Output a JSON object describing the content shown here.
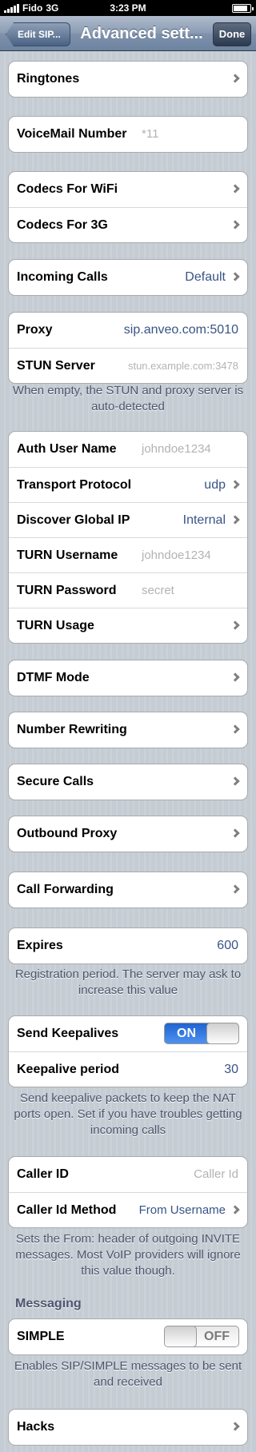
{
  "status_bar": {
    "carrier": "Fido",
    "network": "3G",
    "time": "3:23 PM"
  },
  "nav": {
    "back_label": "Edit SIP...",
    "title": "Advanced sett...",
    "done_label": "Done"
  },
  "ringtones": {
    "label": "Ringtones"
  },
  "voicemail": {
    "label": "VoiceMail Number",
    "placeholder": "*11"
  },
  "codecs": {
    "wifi_label": "Codecs For WiFi",
    "g3_label": "Codecs For 3G"
  },
  "incoming_calls": {
    "label": "Incoming Calls",
    "value": "Default"
  },
  "proxy": {
    "label": "Proxy",
    "value": "sip.anveo.com:5010",
    "stun_label": "STUN Server",
    "stun_placeholder": "stun.example.com:3478",
    "footer": "When empty, the STUN and proxy server is auto-detected"
  },
  "auth": {
    "auth_user_label": "Auth User Name",
    "auth_user_placeholder": "johndoe1234",
    "transport_label": "Transport Protocol",
    "transport_value": "udp",
    "discover_label": "Discover Global IP",
    "discover_value": "Internal",
    "turn_user_label": "TURN Username",
    "turn_user_placeholder": "johndoe1234",
    "turn_pass_label": "TURN Password",
    "turn_pass_placeholder": "secret",
    "turn_usage_label": "TURN Usage"
  },
  "menu": {
    "dtmf": "DTMF Mode",
    "number_rewriting": "Number Rewriting",
    "secure_calls": "Secure Calls",
    "outbound_proxy": "Outbound Proxy",
    "call_forwarding": "Call Forwarding"
  },
  "expires": {
    "label": "Expires",
    "value": "600",
    "footer": "Registration period. The server may ask to increase this value"
  },
  "keepalive": {
    "send_label": "Send Keepalives",
    "switch_text": "ON",
    "send_enabled": true,
    "period_label": "Keepalive period",
    "period_value": "30",
    "footer": "Send keepalive packets to keep the NAT ports open. Set if you have troubles getting incoming calls"
  },
  "caller_id": {
    "label": "Caller ID",
    "placeholder": "Caller Id",
    "method_label": "Caller Id Method",
    "method_value": "From Username",
    "footer": "Sets the From: header of outgoing INVITE messages. Most VoIP providers will ignore this value though."
  },
  "messaging": {
    "header": "Messaging",
    "simple_label": "SIMPLE",
    "switch_text": "OFF",
    "simple_enabled": false,
    "footer": "Enables SIP/SIMPLE messages to be sent and received"
  },
  "hacks": {
    "label": "Hacks"
  }
}
